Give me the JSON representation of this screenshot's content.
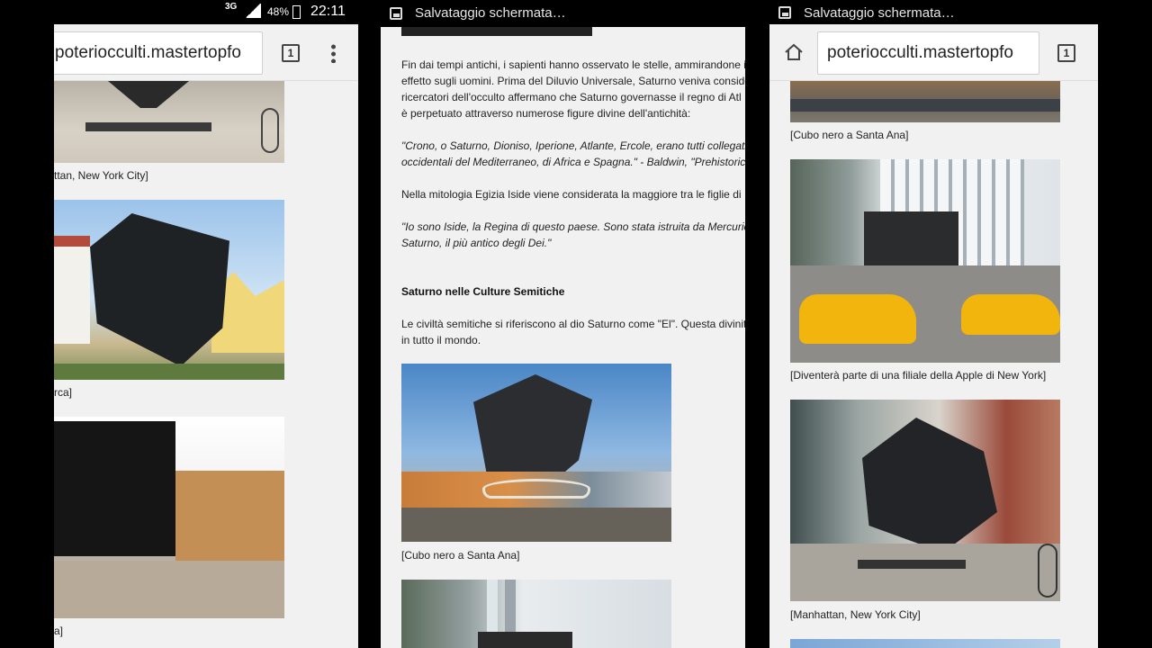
{
  "left": {
    "status": {
      "network": "3G",
      "battery": "48%",
      "time": "22:11"
    },
    "url": "poteriocculti.mastertopfo",
    "tabs_count": "1",
    "captions": [
      "ttan, New York City]",
      "rca]",
      "a]"
    ]
  },
  "middle": {
    "notification": "Salvataggio schermata…",
    "paragraphs": [
      "Fin dai tempi antichi, i sapienti hanno osservato le stelle, ammirandone i",
      "effetto sugli uomini. Prima del Diluvio Universale, Saturno veniva conside",
      "ricercatori dell'occulto affermano che Saturno governasse il regno di Atl",
      "è perpetuato attraverso numerose figure divine dell'antichità:"
    ],
    "quote1": [
      "\"Crono, o Saturno, Dioniso, Iperione, Atlante, Ercole, erano tutti collegati a",
      "occidentali del Mediterraneo, di Africa e Spagna.\" - Baldwin, \"Prehistoric N"
    ],
    "para2": "Nella mitologia Egizia Iside viene considerata la maggiore tra le figlie di",
    "quote2": [
      "\"Io sono Iside, la Regina di questo paese. Sono stata istruita da Mercurio.",
      "Saturno, il più antico degli Dei.\""
    ],
    "heading": "Saturno nelle Culture Semitiche",
    "para3": [
      "Le civiltà semitiche si riferiscono al dio Saturno come \"El\". Questa divinit",
      "in tutto il mondo."
    ],
    "caption": "[Cubo nero a Santa Ana]"
  },
  "right": {
    "notification": "Salvataggio schermata…",
    "url": "poteriocculti.mastertopfo",
    "tabs_count": "1",
    "captions": [
      "[Cubo nero a Santa Ana]",
      "[Diventerà parte di una filiale della Apple di New York]",
      "[Manhattan, New York City]"
    ]
  }
}
